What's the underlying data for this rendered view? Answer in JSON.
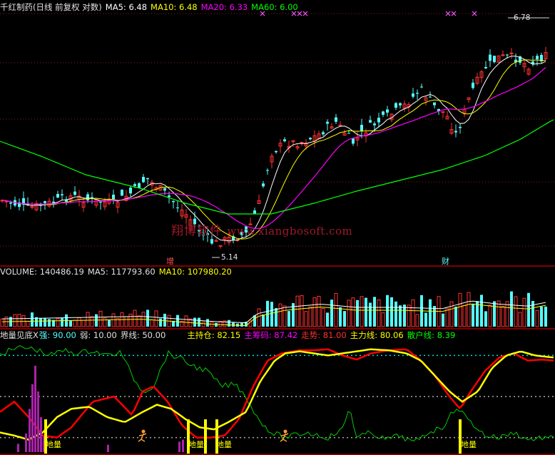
{
  "price_header": {
    "title": "千红制药(日线 前复权 对数)",
    "ma5_label": "MA5:",
    "ma5_value": "6.48",
    "ma10_label": "MA10:",
    "ma10_value": "6.48",
    "ma20_label": "MA20:",
    "ma20_value": "6.33",
    "ma60_label": "MA60:",
    "ma60_value": "6.00"
  },
  "volume_header": {
    "vol_label": "VOLUME:",
    "vol_value": "140486.19",
    "ma5_label": "MA5:",
    "ma5_value": "117793.60",
    "ma10_label": "MA10:",
    "ma10_value": "107980.20"
  },
  "indicator_header": {
    "name": "地量见底X",
    "strong_label": "强:",
    "strong_value": "90.00",
    "weak_label": "弱:",
    "weak_value": "10.00",
    "boundary_label": "界线:",
    "boundary_value": "50.00",
    "holding_label": "主持仓:",
    "holding_value": "82.15",
    "chips_label": "主筹码:",
    "chips_value": "87.42",
    "trend_label": "走势:",
    "trend_value": "81.00",
    "mainline_label": "主力线:",
    "mainline_value": "80.06",
    "retail_label": "散户线:",
    "retail_value": "8.39"
  },
  "annotations": {
    "high_price": "6.78",
    "low_price": "5.14",
    "signal_up": "增",
    "signal_cai": "财",
    "diliang": "地量"
  },
  "watermark": {
    "cn": "翔博软件",
    "url": "www.xiangbosoft.com"
  },
  "colors": {
    "background": "#000000",
    "up_candle": "#ff3232",
    "down_candle": "#54fcfc",
    "ma5": "#ffffff",
    "ma10": "#ffff00",
    "ma20": "#ff00ff",
    "ma60": "#00ff00",
    "holding": "#ff0000",
    "chips": "#ffff00",
    "retail": "#00cc00",
    "divider": "#ff0000"
  },
  "chart_data": [
    {
      "type": "candlestick",
      "title": "千红制药(日线 前复权 对数)",
      "log_scale": true,
      "series": [
        {
          "name": "MA5",
          "last": 6.48
        },
        {
          "name": "MA10",
          "last": 6.48
        },
        {
          "name": "MA20",
          "last": 6.33
        },
        {
          "name": "MA60",
          "last": 6.0
        }
      ],
      "price_annotations": {
        "high": 6.78,
        "low": 5.14
      },
      "signals": [
        "增",
        "财"
      ]
    },
    {
      "type": "bar",
      "title": "VOLUME",
      "series": [
        {
          "name": "VOLUME",
          "last": 140486.19
        },
        {
          "name": "MA5",
          "last": 117793.6
        },
        {
          "name": "MA10",
          "last": 107980.2
        }
      ]
    },
    {
      "type": "line",
      "title": "地量见底X",
      "ylim": [
        0,
        100
      ],
      "levels": {
        "强": 90,
        "弱": 10,
        "界线": 50
      },
      "series": [
        {
          "name": "主持仓",
          "last": 82.15
        },
        {
          "name": "主筹码",
          "last": 87.42
        },
        {
          "name": "走势",
          "last": 81.0
        },
        {
          "name": "主力线",
          "last": 80.06
        },
        {
          "name": "散户线",
          "last": 8.39
        }
      ]
    }
  ]
}
